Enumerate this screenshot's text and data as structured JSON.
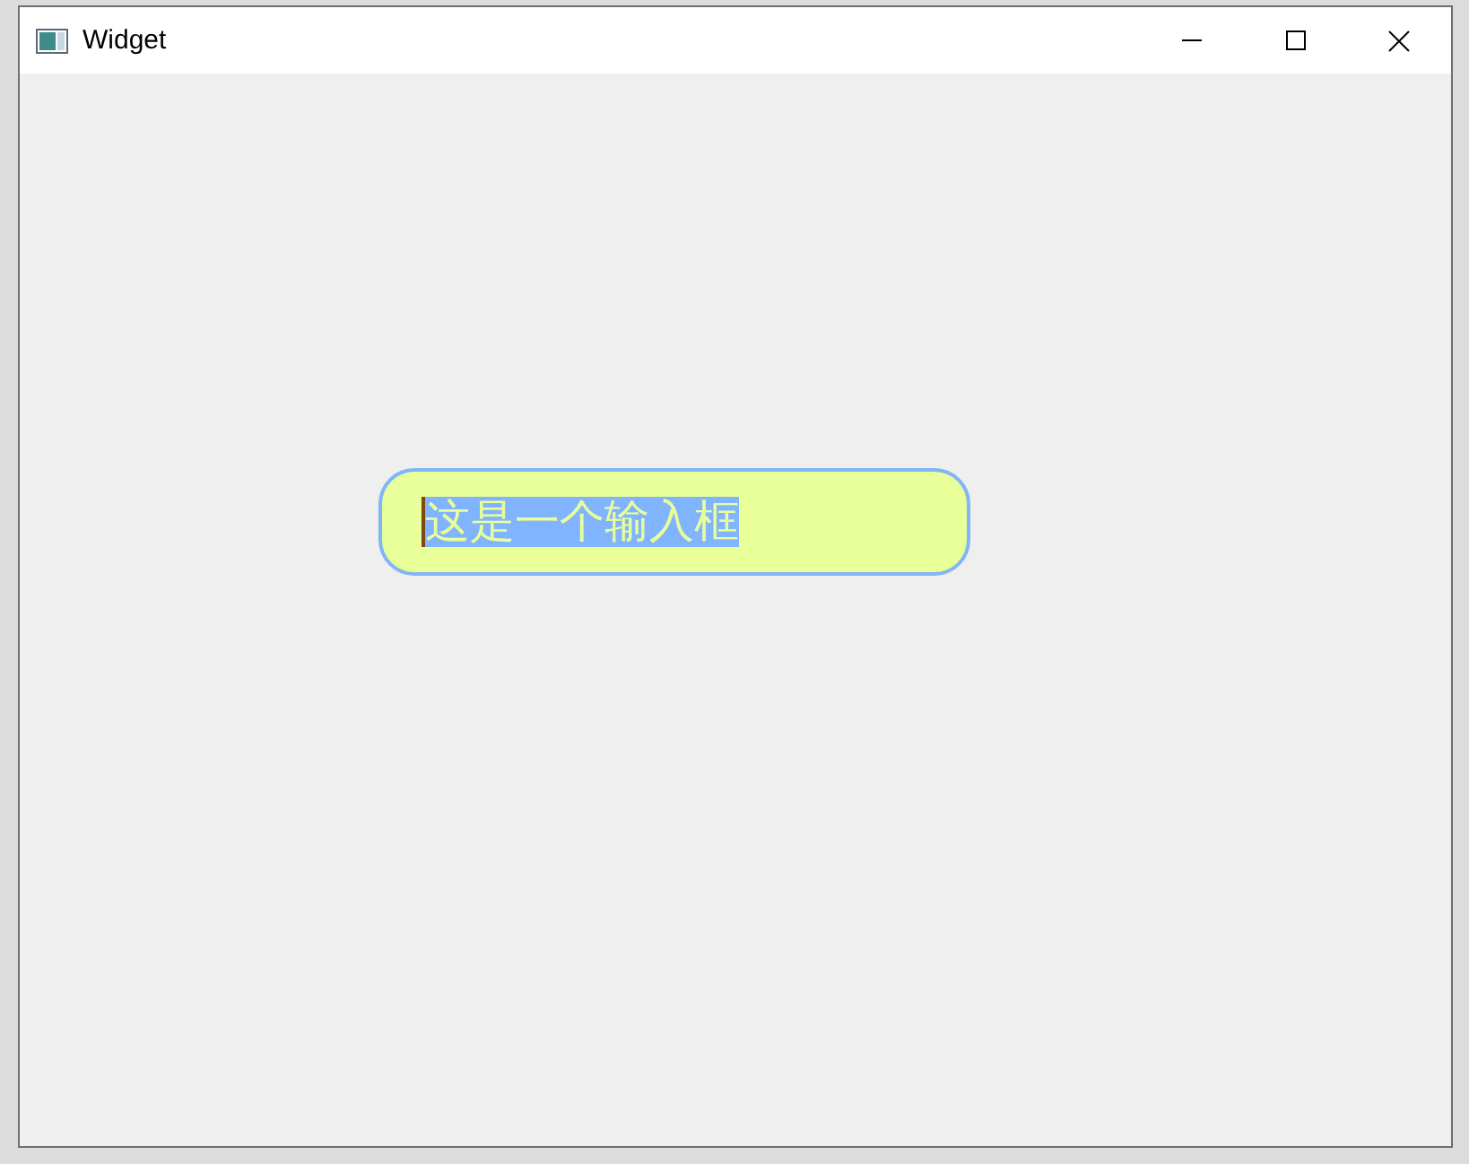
{
  "window": {
    "title": "Widget"
  },
  "input": {
    "value": "这是一个输入框",
    "text_selected": true
  }
}
